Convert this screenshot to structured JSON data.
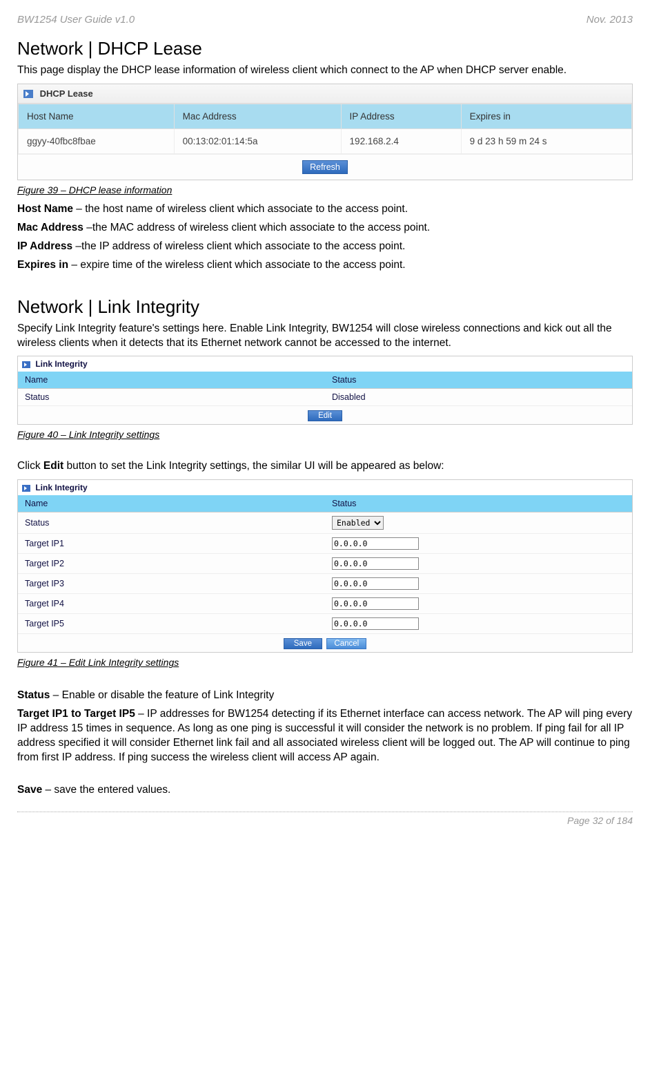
{
  "header": {
    "left": "BW1254 User Guide v1.0",
    "right": "Nov.  2013"
  },
  "section1": {
    "title": "Network | DHCP Lease",
    "intro": "This page display the DHCP lease information of wireless client which connect to the AP when DHCP server enable.",
    "panel_title": "DHCP Lease",
    "columns": [
      "Host Name",
      "Mac Address",
      "IP Address",
      "Expires in"
    ],
    "row": {
      "host": "ggyy-40fbc8fbae",
      "mac": "00:13:02:01:14:5a",
      "ip": "192.168.2.4",
      "exp": "9 d 23 h 59 m 24 s"
    },
    "refresh_btn": "Refresh",
    "caption": "Figure 39 – DHCP lease information",
    "descs": [
      {
        "label": "Host Name",
        "text": " – the host name of wireless client which associate to the access point."
      },
      {
        "label": "Mac Address",
        "text": " –the MAC address of wireless client which associate to the access point."
      },
      {
        "label": "IP Address",
        "text": " –the IP address of wireless client which associate to the access point."
      },
      {
        "label": "Expires in",
        "text": " – expire time of the wireless client which associate to the access point."
      }
    ]
  },
  "section2": {
    "title": "Network | Link Integrity",
    "intro": "Specify Link Integrity feature's settings here. Enable Link Integrity, BW1254 will close wireless connections and kick out all the wireless clients when it detects that its Ethernet network cannot be accessed to the internet.",
    "panel_title": "Link Integrity",
    "col_name": "Name",
    "col_status": "Status",
    "row_name": "Status",
    "row_value": "Disabled",
    "edit_btn": "Edit",
    "caption": "Figure 40 – Link Integrity settings",
    "click_text_pre": "Click ",
    "click_text_bold": "Edit",
    "click_text_post": " button to set the Link Integrity settings, the similar UI will be appeared as below:"
  },
  "section3": {
    "panel_title": "Link Integrity",
    "col_name": "Name",
    "col_status": "Status",
    "status_label": "Status",
    "status_value": "Enabled",
    "targets": [
      {
        "label": "Target IP1",
        "value": "0.0.0.0"
      },
      {
        "label": "Target IP2",
        "value": "0.0.0.0"
      },
      {
        "label": "Target IP3",
        "value": "0.0.0.0"
      },
      {
        "label": "Target IP4",
        "value": "0.0.0.0"
      },
      {
        "label": "Target IP5",
        "value": "0.0.0.0"
      }
    ],
    "save_btn": "Save",
    "cancel_btn": "Cancel",
    "caption": "Figure 41 – Edit  Link Integrity settings",
    "status_desc_label": "Status",
    "status_desc_text": " – Enable or disable the feature of Link Integrity",
    "target_desc_label": "Target IP1 to Target IP5",
    "target_desc_text": " – IP addresses for BW1254 detecting if its Ethernet interface can access network. The AP will ping every IP address 15 times in sequence. As long as one ping is successful it will consider the network is no problem. If ping fail for all IP address specified  it will consider Ethernet link fail and all associated wireless client will be logged out. The AP will continue to ping from first IP address. If ping success the wireless client will access AP again.",
    "save_desc_label": "Save",
    "save_desc_text": " – save the entered values."
  },
  "footer": "Page 32 of 184"
}
